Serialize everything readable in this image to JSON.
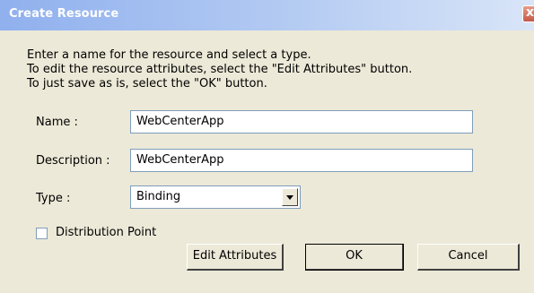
{
  "dialog": {
    "title": "Create Resource",
    "close_glyph": "x",
    "instructions": [
      "Enter a name for the resource and select a type.",
      "To edit the resource attributes, select the \"Edit Attributes\" button.",
      "To just save as is, select the \"OK\" button."
    ]
  },
  "form": {
    "name_label": "Name :",
    "name_value": "WebCenterApp",
    "description_label": "Description :",
    "description_value": "WebCenterApp",
    "type_label": "Type :",
    "type_value": "Binding",
    "distribution_label": "Distribution Point",
    "distribution_checked": false
  },
  "buttons": {
    "edit_attributes": "Edit Attributes",
    "ok": "OK",
    "cancel": "Cancel"
  },
  "icons": {
    "close": "close-icon",
    "dropdown": "chevron-down-icon"
  },
  "colors": {
    "dialog_background": "#ece9d8",
    "titlebar_start": "#90b0ee",
    "titlebar_end": "#d9e5f8",
    "field_border": "#7f9db9"
  }
}
